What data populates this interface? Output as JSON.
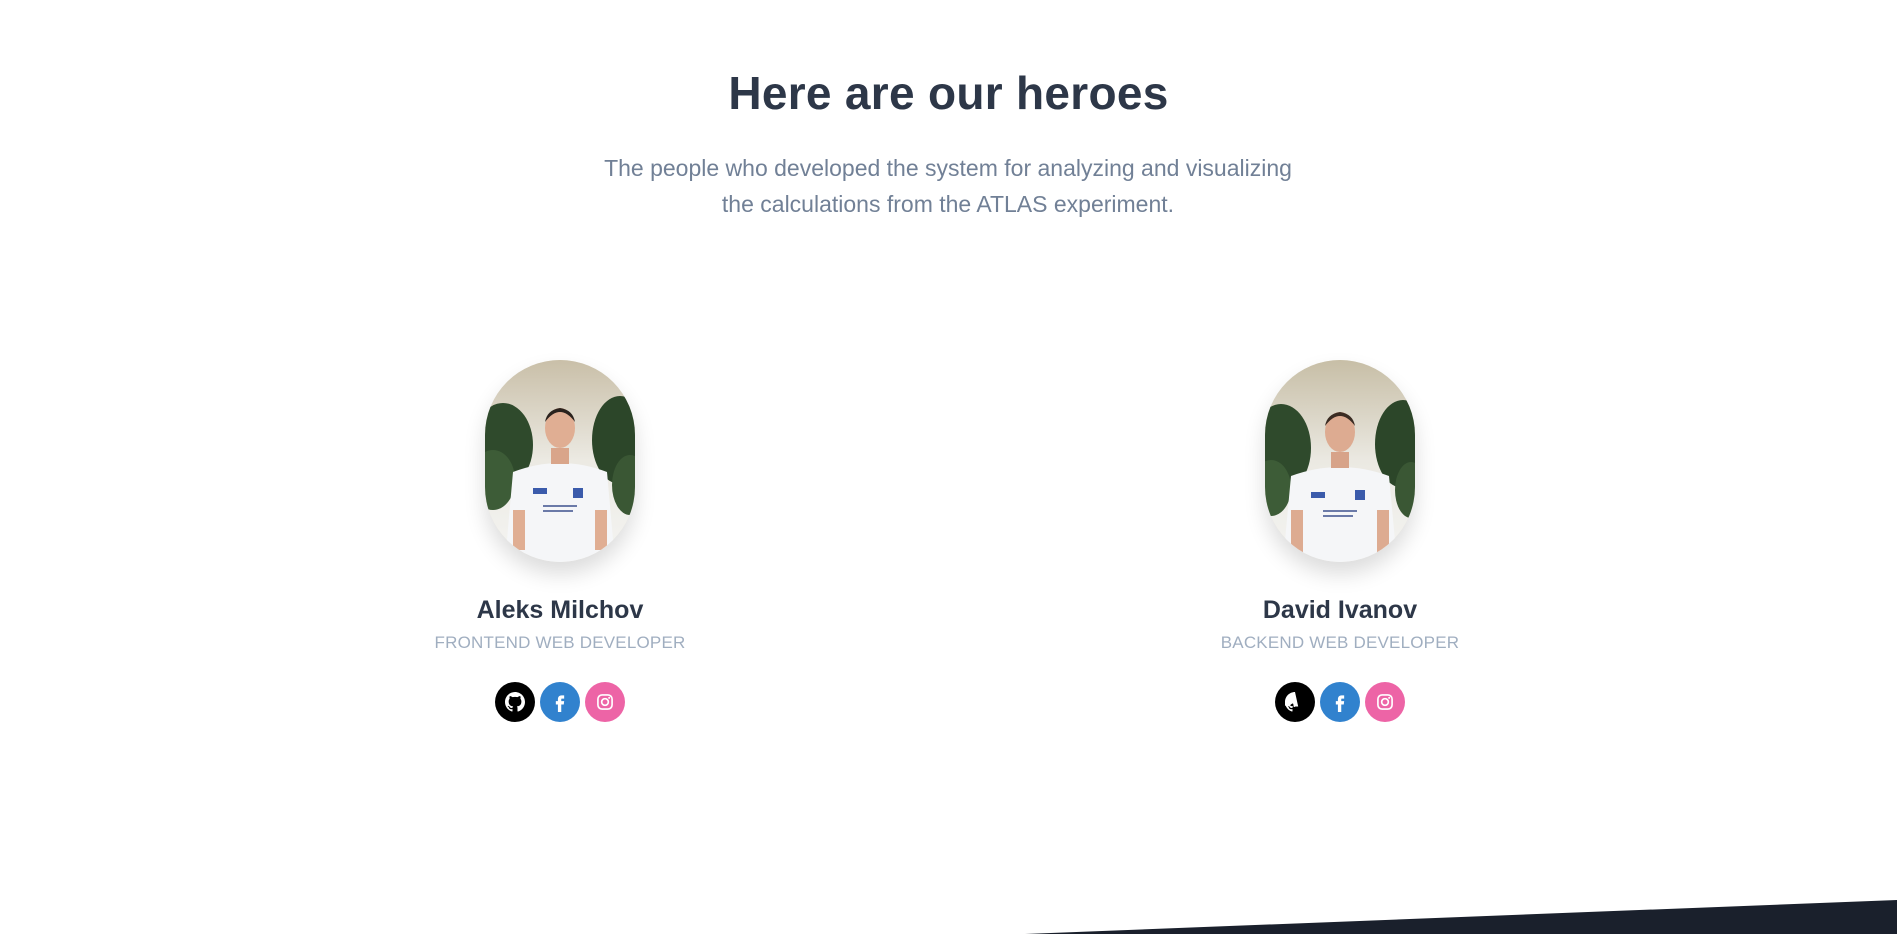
{
  "section": {
    "title": "Here are our heroes",
    "description": "The people who developed the system for analyzing and visualizing the calculations from the ATLAS experiment."
  },
  "team": [
    {
      "name": "Aleks Milchov",
      "role": "Frontend Web Developer",
      "socials": [
        {
          "icon": "github-icon",
          "color": "#000000"
        },
        {
          "icon": "facebook-icon",
          "color": "#3182ce"
        },
        {
          "icon": "instagram-icon",
          "color": "#ed64a6"
        }
      ]
    },
    {
      "name": "David Ivanov",
      "role": "Backend Web Developer",
      "socials": [
        {
          "icon": "github-icon",
          "color": "#000000"
        },
        {
          "icon": "facebook-icon",
          "color": "#3182ce"
        },
        {
          "icon": "instagram-icon",
          "color": "#ed64a6"
        }
      ]
    }
  ],
  "colors": {
    "heading": "#2d3748",
    "text_muted": "#718096",
    "role": "#a0aec0",
    "footer": "#1a202c"
  }
}
